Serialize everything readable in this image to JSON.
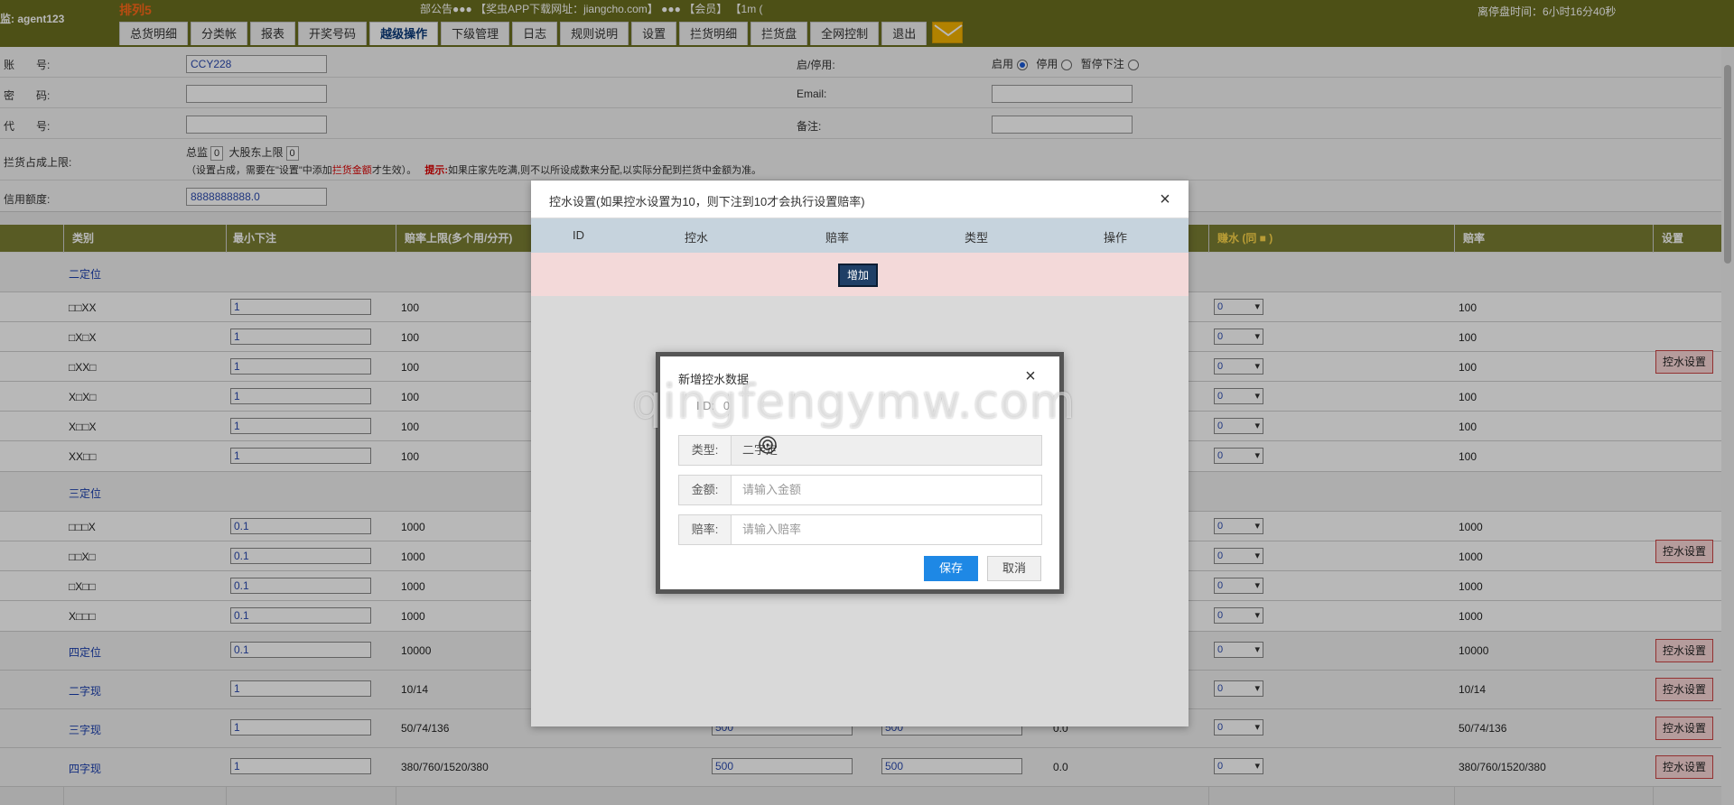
{
  "topbar": {
    "user": "监: agent123",
    "brand": "排列5",
    "notice": "部公告●●● 【奖虫APP下载网址：jiangcho.com】 ●●● 【会员】 【1m (",
    "timer": "离停盘时间：6小时16分40秒"
  },
  "tabs": [
    {
      "label": "总货明细"
    },
    {
      "label": "分类帐"
    },
    {
      "label": "报表"
    },
    {
      "label": "开奖号码"
    },
    {
      "label": "越级操作"
    },
    {
      "label": "下级管理"
    },
    {
      "label": "日志"
    },
    {
      "label": "规则说明"
    },
    {
      "label": "设置"
    },
    {
      "label": "拦货明细"
    },
    {
      "label": "拦货盘"
    },
    {
      "label": "全网控制"
    },
    {
      "label": "退出"
    }
  ],
  "form": {
    "account_label": "账　　号:",
    "account_value": "CCY228",
    "password_label": "密　　码:",
    "code_label": "代　　号:",
    "limit_label": "拦货占成上限:",
    "limit_line1_a": "总监",
    "limit_sel1": "0",
    "limit_line1_b": "大股东上限",
    "limit_sel2": "0",
    "limit_line2_a": "（设置占成，需要在\"设置\"中添加",
    "limit_line2_red": "拦货金额",
    "limit_line2_b": "才生效）。",
    "limit_tip_label": "提示:",
    "limit_tip": "如果庄家先吃满,则不以所设成数来分配,以实际分配到拦货中金额为准。",
    "credit_label": "信用额度:",
    "credit_value": "8888888888.0",
    "status_label": "启/停用:",
    "status_enable": "启用",
    "status_disable": "停用",
    "status_pause": "暂停下注",
    "email_label": "Email:",
    "remark_label": "备注:"
  },
  "table": {
    "headers": {
      "category": "类别",
      "min_bet": "最小下注",
      "odds_limit": "赔率上限(多个用/分开)",
      "rebate": "赚水 (同 ■ )",
      "odds": "赔率",
      "settings": "设置"
    },
    "control_label": "控水设置",
    "groups": {
      "g1": "二定位",
      "g2": "三定位"
    },
    "rows": [
      {
        "cat": "□□XX",
        "min": "1",
        "limit": "100",
        "rebate": "0",
        "odds": "100"
      },
      {
        "cat": "□X□X",
        "min": "1",
        "limit": "100",
        "rebate": "0",
        "odds": "100"
      },
      {
        "cat": "□XX□",
        "min": "1",
        "limit": "100",
        "rebate": "0",
        "odds": "100"
      },
      {
        "cat": "X□X□",
        "min": "1",
        "limit": "100",
        "rebate": "0",
        "odds": "100"
      },
      {
        "cat": "X□□X",
        "min": "1",
        "limit": "100",
        "rebate": "0",
        "odds": "100"
      },
      {
        "cat": "XX□□",
        "min": "1",
        "limit": "100",
        "rebate": "0",
        "odds": "100"
      },
      {
        "cat": "□□□X",
        "min": "0.1",
        "limit": "1000",
        "rebate": "0",
        "odds": "1000"
      },
      {
        "cat": "□□X□",
        "min": "0.1",
        "limit": "1000",
        "rebate": "0",
        "odds": "1000"
      },
      {
        "cat": "□X□□",
        "min": "0.1",
        "limit": "1000",
        "rebate": "0",
        "odds": "1000"
      },
      {
        "cat": "X□□□",
        "min": "0.1",
        "limit": "1000",
        "rebate": "0",
        "odds": "1000"
      },
      {
        "cat": "四定位",
        "min": "0.1",
        "limit": "10000",
        "rebate": "0",
        "odds": "10000"
      },
      {
        "cat": "二字现",
        "min": "1",
        "limit": "10/14",
        "rebate": "0",
        "odds": "10/14"
      },
      {
        "cat": "三字现",
        "min": "1",
        "limit": "50/74/136",
        "mid1": "500",
        "mid2": "500",
        "mid3": "0.0",
        "rebate": "0",
        "odds": "50/74/136"
      },
      {
        "cat": "四字现",
        "min": "1",
        "limit": "380/760/1520/380",
        "mid1": "500",
        "mid2": "500",
        "mid3": "0.0",
        "rebate": "0",
        "odds": "380/760/1520/380"
      }
    ]
  },
  "modal1": {
    "title": "控水设置(如果控水设置为10，则下注到10才会执行设置赔率)",
    "columns": [
      "ID",
      "控水",
      "赔率",
      "类型",
      "操作"
    ],
    "add_label": "增加"
  },
  "modal2": {
    "title": "新增控水数据",
    "id_label": "I D:",
    "id_value": "0",
    "type_label": "类型:",
    "type_value": "二字定",
    "amount_label": "金额:",
    "amount_placeholder": "请输入金额",
    "odds_label": "赔率:",
    "odds_placeholder": "请输入赔率",
    "save_label": "保存",
    "cancel_label": "取消"
  },
  "watermark": "qingfengymw.com"
}
